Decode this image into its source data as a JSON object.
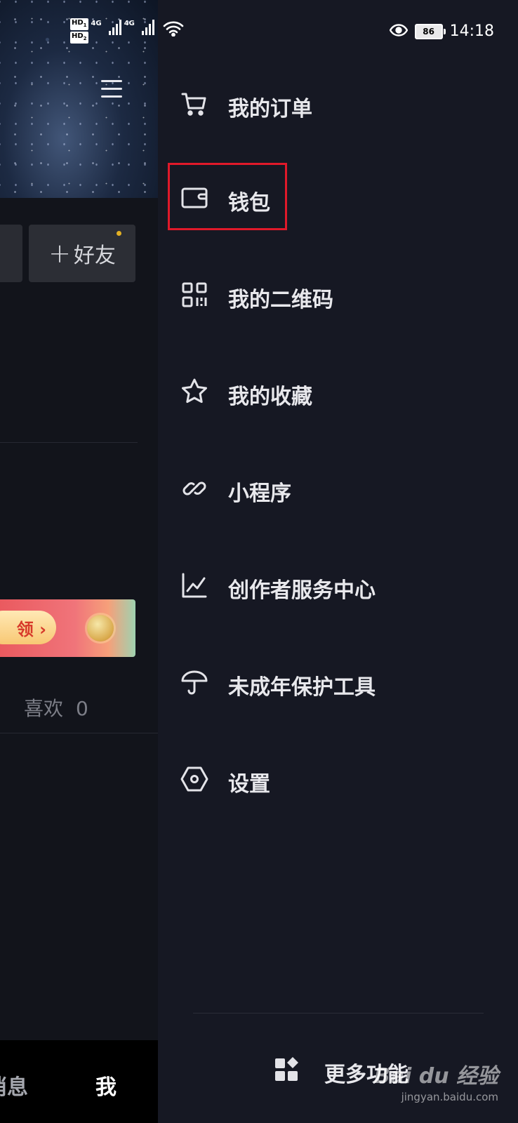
{
  "status_bar": {
    "hd1": "HD",
    "hd1_sub": "1",
    "hd2": "HD",
    "hd2_sub": "2",
    "sim1_network": "4G",
    "sim2_network": "4G",
    "battery": "86",
    "time": "14:18"
  },
  "profile_background": {
    "add_friend_label": "好友",
    "add_friend_plus": "+",
    "promo_claim_label": "领 ›",
    "likes_tab_label": "喜欢",
    "likes_count": "0"
  },
  "bottom_nav": {
    "messages_label_partial": "消息",
    "me_label": "我"
  },
  "drawer": {
    "items": [
      {
        "label": "我的订单",
        "icon": "cart-icon"
      },
      {
        "label": "钱包",
        "icon": "wallet-icon"
      },
      {
        "label": "我的二维码",
        "icon": "qr-code-icon"
      },
      {
        "label": "我的收藏",
        "icon": "star-icon"
      },
      {
        "label": "小程序",
        "icon": "link-icon"
      },
      {
        "label": "创作者服务中心",
        "icon": "chart-icon"
      },
      {
        "label": "未成年保护工具",
        "icon": "umbrella-icon"
      },
      {
        "label": "设置",
        "icon": "settings-icon"
      }
    ],
    "more_features_label": "更多功能",
    "highlight_color": "#e0192a"
  },
  "watermark": {
    "brand": "Bai du 经验",
    "url": "jingyan.baidu.com"
  }
}
